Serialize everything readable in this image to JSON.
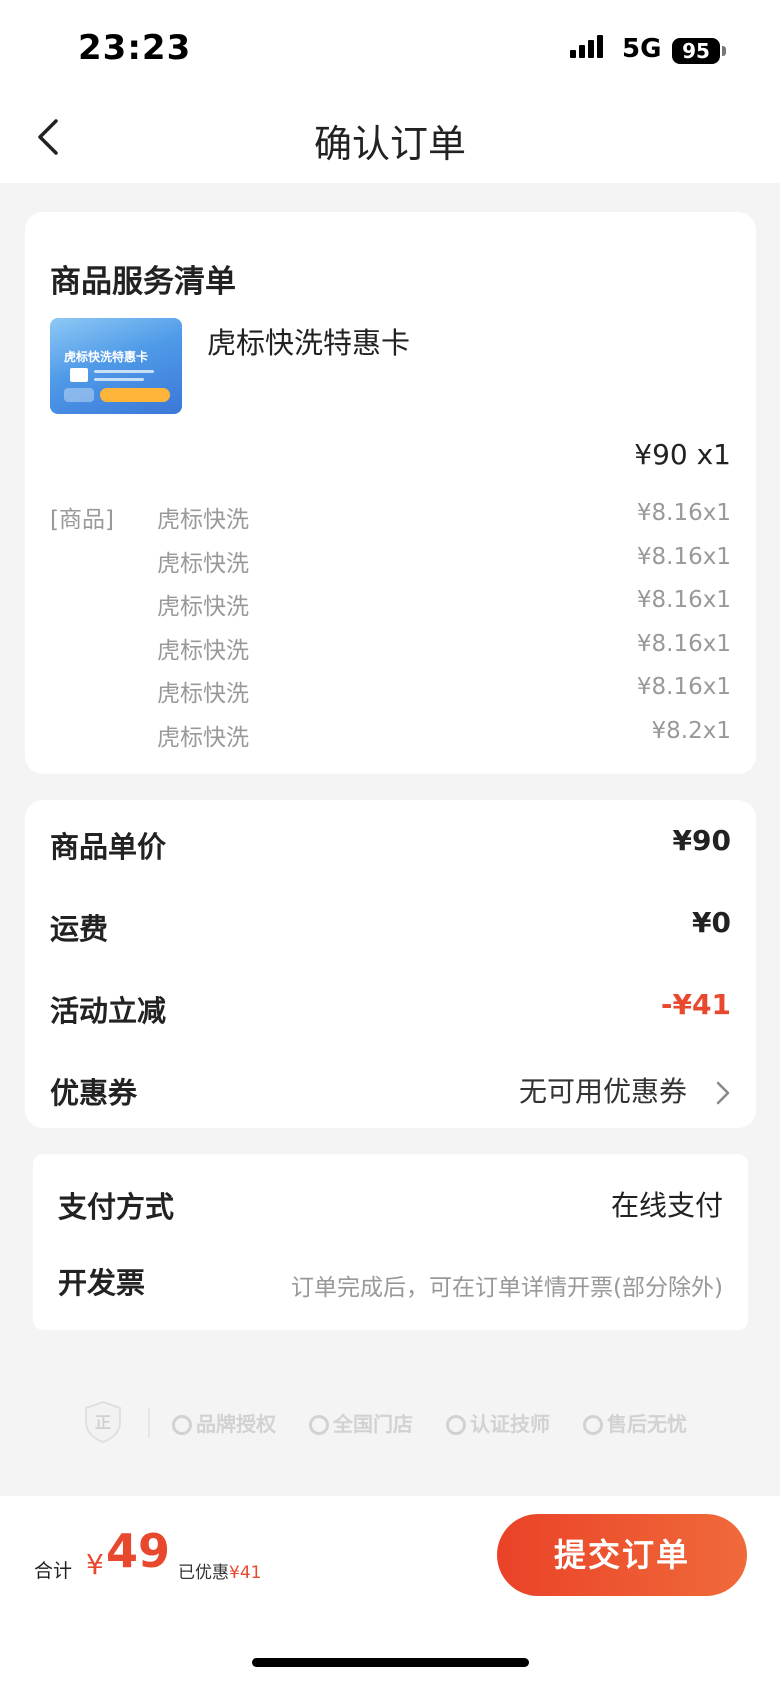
{
  "status": {
    "time": "23:23",
    "network": "5G",
    "battery": "95"
  },
  "nav": {
    "title": "确认订单"
  },
  "order": {
    "section_title": "商品服务清单",
    "product_name": "虎标快洗特惠卡",
    "thumb_title": "虎标快洗特惠卡",
    "price_qty": "¥90 x1",
    "items": [
      {
        "tag": "[商品]",
        "name": "虎标快洗",
        "price": "¥8.16x1"
      },
      {
        "tag": "",
        "name": "虎标快洗",
        "price": "¥8.16x1"
      },
      {
        "tag": "",
        "name": "虎标快洗",
        "price": "¥8.16x1"
      },
      {
        "tag": "",
        "name": "虎标快洗",
        "price": "¥8.16x1"
      },
      {
        "tag": "",
        "name": "虎标快洗",
        "price": "¥8.16x1"
      },
      {
        "tag": "",
        "name": "虎标快洗",
        "price": "¥8.2x1"
      }
    ]
  },
  "pricing": {
    "unit_price_label": "商品单价",
    "unit_price": "¥90",
    "shipping_label": "运费",
    "shipping": "¥0",
    "discount_label": "活动立减",
    "discount": "-¥41",
    "coupon_label": "优惠券",
    "coupon_value": "无可用优惠券"
  },
  "payment": {
    "method_label": "支付方式",
    "method_value": "在线支付",
    "invoice_label": "开发票",
    "invoice_hint": "订单完成后，可在订单详情开票(部分除外)"
  },
  "trust": {
    "badge": "正",
    "items": [
      "品牌授权",
      "全国门店",
      "认证技师",
      "售后无忧"
    ]
  },
  "footer": {
    "total_label": "合计",
    "currency": "¥",
    "total_value": "49",
    "saved_label": "已优惠",
    "saved_amount": "¥41",
    "submit_label": "提交订单"
  },
  "colors": {
    "accent": "#e8492e",
    "page_bg": "#f4f4f4"
  }
}
